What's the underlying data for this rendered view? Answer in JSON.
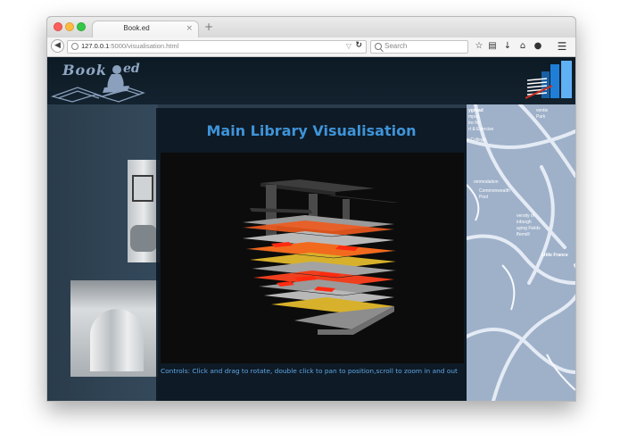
{
  "browser": {
    "tab_title": "Book.ed",
    "tab_close": "×",
    "new_tab": "+",
    "url_host": "127.0.0.1",
    "url_path": ":5000/visualisation.html",
    "search_placeholder": "Search",
    "icons": [
      "back-icon",
      "globe-icon",
      "reload-icon",
      "search-icon",
      "bookmark-star-icon",
      "clipboard-icon",
      "download-icon",
      "home-icon",
      "chat-icon",
      "menu-icon"
    ]
  },
  "site": {
    "logo_text": "Book",
    "logo_suffix": "ed"
  },
  "map": {
    "labels": [
      "ygroad",
      "mpus",
      "tre for",
      "rt & Exercise",
      "i College",
      "ommodation",
      "Commonwealth",
      "Pool",
      "versity of",
      "inburgh",
      "aying Fields",
      "ffermill",
      "Little France",
      "ventie",
      "Park"
    ]
  },
  "modal": {
    "title": "Main Library Visualisation",
    "controls": "Controls: Click and drag to rotate, double click to pan to position,scroll to zoom in and out"
  },
  "colors": {
    "title_blue": "#3f94d9",
    "controls_blue": "#5ea6e6",
    "floor_orange": "#ef5a1e",
    "floor_grey": "#a3a3a3",
    "floor_yellow": "#d7b12b"
  }
}
